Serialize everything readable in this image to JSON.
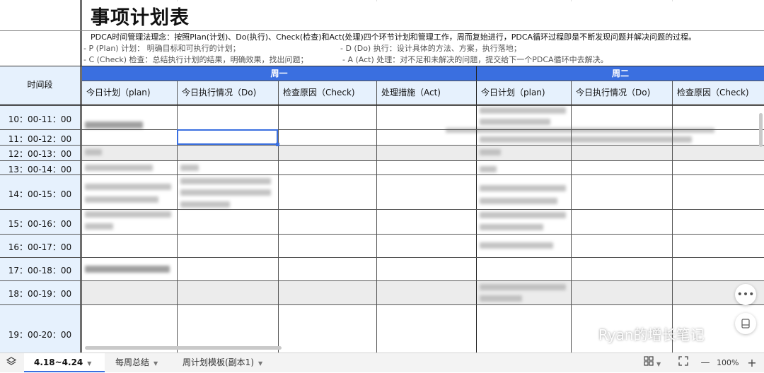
{
  "sheet": {
    "title": "事项计划表",
    "desc_main": "PDCA时间管理法理念：按照Plan(计划)、Do(执行)、Check(检查)和Act(处理)四个环节计划和管理工作，周而复始进行，PDCA循环过程即是不断发现问题并解决问题的过程。",
    "desc_p": "- P (Plan) 计划： 明确目标和可执行的计划；",
    "desc_d": "- D (Do) 执行：设计具体的方法、方案，执行落地；",
    "desc_c": "- C (Check) 检查：总结执行计划的结果，明确效果，找出问题；",
    "desc_a": "- A (Act) 处理：对不足和未解决的问题，提交给下一个PDCA循环中去解决。",
    "time_header": "时间段",
    "days": [
      "周一",
      "周二"
    ],
    "columns": [
      "今日计划（plan)",
      "今日执行情况（Do)",
      "检查原因（Check)",
      "处理措施（Act)",
      "今日计划（plan)",
      "今日执行情况（Do)",
      "检查原因（Check)"
    ],
    "time_slots": [
      "10：00-11：00",
      "11：00-12：00",
      "12：00-13：00",
      "13：00-14：00",
      "14：00-15：00",
      "15：00-16：00",
      "16：00-17：00",
      "17：00-18：00",
      "18：00-19：00",
      "19：00-20：00"
    ]
  },
  "tabs": [
    {
      "label": "4.18~4.24",
      "active": true
    },
    {
      "label": "每周总结",
      "active": false
    },
    {
      "label": "周计划模板(副本1)",
      "active": false
    }
  ],
  "zoom": {
    "level": "100%",
    "minus": "—",
    "plus": "+"
  },
  "watermark": "Ryan的增长笔记",
  "colors": {
    "accent": "#3a6fe0",
    "header_bg": "#e6f1fd",
    "grey_row": "#ececec"
  }
}
